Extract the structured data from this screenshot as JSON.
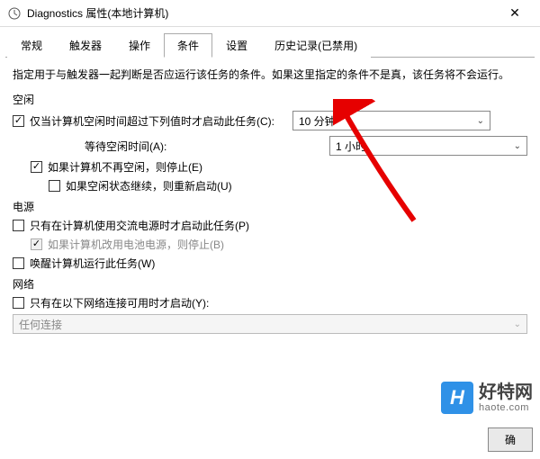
{
  "window": {
    "title": "Diagnostics 属性(本地计算机)"
  },
  "tabs": {
    "items": [
      "常规",
      "触发器",
      "操作",
      "条件",
      "设置",
      "历史记录(已禁用)"
    ],
    "active_index": 3
  },
  "description": "指定用于与触发器一起判断是否应运行该任务的条件。如果这里指定的条件不是真，该任务将不会运行。",
  "sections": {
    "idle": {
      "label": "空闲",
      "start_on_idle": {
        "label": "仅当计算机空闲时间超过下列值时才启动此任务(C):",
        "checked": true
      },
      "idle_duration": {
        "value": "10 分钟"
      },
      "wait_label": "等待空闲时间(A):",
      "wait_duration": {
        "value": "1 小时"
      },
      "stop_if_not_idle": {
        "label": "如果计算机不再空闲，则停止(E)",
        "checked": true
      },
      "restart_if_idle": {
        "label": "如果空闲状态继续，则重新启动(U)",
        "checked": false
      }
    },
    "power": {
      "label": "电源",
      "ac_only": {
        "label": "只有在计算机使用交流电源时才启动此任务(P)",
        "checked": false
      },
      "stop_on_battery": {
        "label": "如果计算机改用电池电源，则停止(B)",
        "checked": true,
        "disabled": true
      },
      "wake": {
        "label": "唤醒计算机运行此任务(W)",
        "checked": false
      }
    },
    "network": {
      "label": "网络",
      "only_if_network": {
        "label": "只有在以下网络连接可用时才启动(Y):",
        "checked": false
      },
      "connection": {
        "value": "任何连接",
        "disabled": true
      }
    }
  },
  "footer": {
    "ok": "确"
  },
  "watermark": {
    "logo": "H",
    "cn": "好特网",
    "en": "haote.com"
  }
}
